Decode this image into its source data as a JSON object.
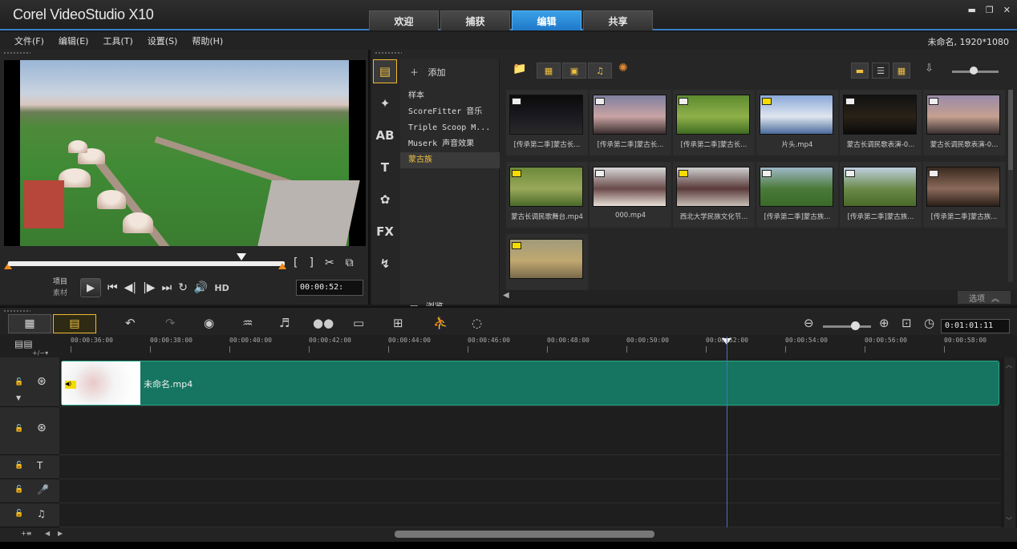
{
  "app": {
    "title": "Corel VideoStudio X10",
    "tabs": [
      {
        "label": "欢迎"
      },
      {
        "label": "捕获"
      },
      {
        "label": "编辑"
      },
      {
        "label": "共享"
      }
    ],
    "active_tab": "编辑",
    "accent": "#2a8ad8"
  },
  "menu": {
    "items": [
      {
        "label": "文件(F)"
      },
      {
        "label": "编辑(E)"
      },
      {
        "label": "工具(T)"
      },
      {
        "label": "设置(S)"
      },
      {
        "label": "帮助(H)"
      }
    ],
    "project_info": "未命名, 1920*1080"
  },
  "player": {
    "mode_project": "项目",
    "mode_clip": "素材",
    "timecode": "00:00:52:",
    "hd": "HD"
  },
  "library": {
    "add_label": "添加",
    "browse_label": "浏览",
    "options_label": "选项",
    "folders": [
      {
        "label": "样本"
      },
      {
        "label": "ScoreFitter 音乐"
      },
      {
        "label": "Triple Scoop M..."
      },
      {
        "label": "Muserk 声音效果"
      },
      {
        "label": "蒙古族"
      }
    ],
    "active_folder": "蒙古族",
    "thumbnails": [
      {
        "caption": "[传承第二季]蒙古长...",
        "badge": "white",
        "colors": [
          "#0b0b0b",
          "#1a1a20",
          "#2a2a2a"
        ]
      },
      {
        "caption": "[传承第二季]蒙古长...",
        "badge": "white",
        "colors": [
          "#7f7fa0",
          "#c9a3a3",
          "#3a2e2e"
        ]
      },
      {
        "caption": "[传承第二季]蒙古长...",
        "badge": "white",
        "colors": [
          "#5d8a2f",
          "#8fb04a",
          "#3f6b22"
        ]
      },
      {
        "caption": "片头.mp4",
        "badge": "yellow",
        "colors": [
          "#8aa8d8",
          "#dfe6ef",
          "#4a6a9a"
        ]
      },
      {
        "caption": "蒙古长调民歌表演-0...",
        "badge": "white",
        "colors": [
          "#111",
          "#2a2218",
          "#0a0a0a"
        ]
      },
      {
        "caption": "蒙古长调民歌表演-0...",
        "badge": "white",
        "colors": [
          "#9a8aa8",
          "#c4a090",
          "#3a3030"
        ]
      },
      {
        "caption": "蒙古长调民歌舞台.mp4",
        "badge": "yellow",
        "colors": [
          "#6b8a3a",
          "#9aa85a",
          "#4a6a2a"
        ]
      },
      {
        "caption": "000.mp4",
        "badge": "white",
        "colors": [
          "#d8d8d8",
          "#6a4a4a",
          "#e8e0d8"
        ]
      },
      {
        "caption": "西北大学民族文化节...",
        "badge": "yellow",
        "colors": [
          "#d0d0d0",
          "#5a3a3a",
          "#c8c0b8"
        ]
      },
      {
        "caption": "[传承第二季]蒙古族...",
        "badge": "white",
        "colors": [
          "#a0b8c8",
          "#4a7a3a",
          "#3a6a2a"
        ]
      },
      {
        "caption": "[传承第二季]蒙古族...",
        "badge": "white",
        "colors": [
          "#c0d0e0",
          "#6a8a4a",
          "#4a6a2a"
        ]
      },
      {
        "caption": "[传承第二季]蒙古族...",
        "badge": "white",
        "colors": [
          "#3a2a20",
          "#8a6a5a",
          "#2a1e18"
        ]
      },
      {
        "caption": "",
        "badge": "yellow",
        "colors": [
          "#a09a7a",
          "#c0a870",
          "#7a6a4a"
        ]
      }
    ]
  },
  "timeline": {
    "timecode": "0:01:01:11",
    "ruler": [
      "00:00:36:00",
      "00:00:38:00",
      "00:00:40:00",
      "00:00:42:00",
      "00:00:44:00",
      "00:00:46:00",
      "00:00:48:00",
      "00:00:50:00",
      "00:00:52:00",
      "00:00:54:00",
      "00:00:56:00",
      "00:00:58:00"
    ],
    "clip_label": "未命名.mp4",
    "clip_color": "#157560"
  }
}
